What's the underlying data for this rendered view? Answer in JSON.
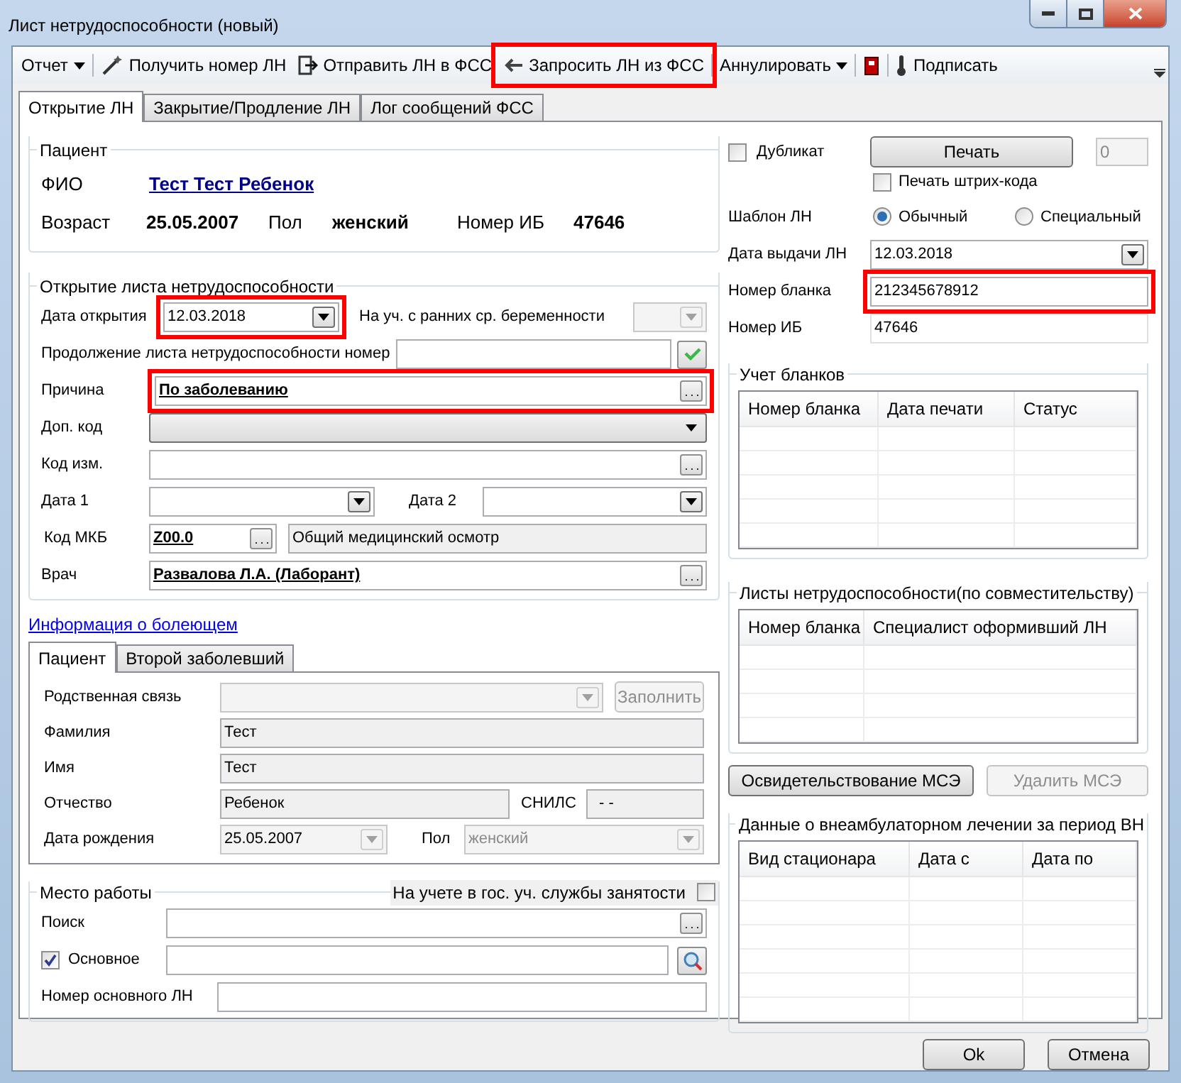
{
  "window": {
    "title": "Лист нетрудоспособности (новый)"
  },
  "toolbar": [
    {
      "kind": "dropdown",
      "label": "Отчет",
      "highlighted": false
    },
    {
      "kind": "button",
      "label": "Получить номер ЛН",
      "highlighted": false
    },
    {
      "kind": "button",
      "label": "Отправить ЛН в ФСС",
      "highlighted": false
    },
    {
      "kind": "button",
      "label": "Запросить ЛН из ФСС",
      "highlighted": true
    },
    {
      "kind": "dropdown",
      "label": "Аннулировать",
      "highlighted": false
    },
    {
      "kind": "icon",
      "highlighted": false
    },
    {
      "kind": "button",
      "label": "Подписать",
      "highlighted": false
    }
  ],
  "tabs": [
    {
      "label": "Открытие ЛН",
      "selected": true
    },
    {
      "label": "Закрытие/Продление ЛН",
      "selected": false
    },
    {
      "label": "Лог сообщений ФСС",
      "selected": false
    }
  ],
  "patient": {
    "title": "Пациент",
    "fio_label": "ФИО",
    "fio": "Тест Тест Ребенок",
    "age_label": "Возраст",
    "age": "25.05.2007",
    "sex_label": "Пол",
    "sex": "женский",
    "ib_label": "Номер ИБ",
    "ib": "47646"
  },
  "opening": {
    "title": "Открытие листа нетрудоспособности",
    "open_date": {
      "label": "Дата открытия",
      "value": "12.03.2018",
      "highlighted": true
    },
    "pregnancy": {
      "label": "На уч. с ранних ср. беременности",
      "disabled": true
    },
    "continuation": {
      "label": "Продолжение листа нетрудоспособности номер"
    },
    "reason": {
      "label": "Причина",
      "value": "По заболеванию",
      "highlighted": true
    },
    "extra_code": {
      "label": "Доп. код"
    },
    "change_code": {
      "label": "Код изм."
    },
    "date1": {
      "label": "Дата 1"
    },
    "date2": {
      "label": "Дата 2"
    },
    "mkb": {
      "label": "Код МКБ",
      "code": "Z00.0",
      "description": "Общий медицинский осмотр"
    },
    "doctor": {
      "label": "Врач",
      "value": "Развалова Л.А. (Лаборант)"
    }
  },
  "sick_info_link": "Информация о болеющем",
  "sub_tabs": [
    {
      "label": "Пациент",
      "selected": true
    },
    {
      "label": "Второй заболевший",
      "selected": false
    }
  ],
  "patient_info": {
    "relation": {
      "label": "Родственная связь",
      "disabled": true
    },
    "fill_button": {
      "label": "Заполнить",
      "disabled": true
    },
    "surname": {
      "label": "Фамилия",
      "value": "Тест"
    },
    "name": {
      "label": "Имя",
      "value": "Тест"
    },
    "patronymic": {
      "label": "Отчество",
      "value": "Ребенок"
    },
    "snils": {
      "label": "СНИЛС",
      "value": "-  -"
    },
    "birth_date": {
      "label": "Дата рождения",
      "value": "25.05.2007"
    },
    "sex": {
      "label": "Пол",
      "value": "женский"
    }
  },
  "work": {
    "title": "Место работы",
    "unemployed": {
      "label": "На учете в гос. уч. службы занятости",
      "checked": false
    },
    "search": {
      "label": "Поиск"
    },
    "main": {
      "label": "Основное",
      "checked": true
    },
    "main_number": {
      "label": "Номер основного ЛН"
    }
  },
  "right": {
    "duplicate": {
      "label": "Дубликат",
      "checked": false
    },
    "print_button": "Печать",
    "copies": "0",
    "barcode": {
      "label": "Печать штрих-кода",
      "checked": false
    },
    "template": {
      "label": "Шаблон ЛН",
      "options": [
        {
          "label": "Обычный",
          "selected": true
        },
        {
          "label": "Специальный",
          "selected": false
        }
      ]
    },
    "issue_date": {
      "label": "Дата выдачи ЛН",
      "value": "12.03.2018"
    },
    "blank_number": {
      "label": "Номер бланка",
      "value": "212345678912",
      "highlighted": true
    },
    "ib_number": {
      "label": "Номер ИБ",
      "value": "47646"
    }
  },
  "blanks": {
    "title": "Учет бланков",
    "columns": [
      "Номер бланка",
      "Дата печати",
      "Статус"
    ]
  },
  "part_time": {
    "title": "Листы нетрудоспособности(по совместительству)",
    "columns": [
      "Номер бланка",
      "Специалист оформивший ЛН"
    ]
  },
  "mse_buttons": [
    {
      "label": "Освидетельствование МСЭ",
      "disabled": false
    },
    {
      "label": "Удалить МСЭ",
      "disabled": true
    }
  ],
  "inpatient": {
    "title": "Данные о внеамбулаторном лечении за период ВН",
    "columns": [
      "Вид стационара",
      "Дата с",
      "Дата по"
    ]
  },
  "footer": [
    "Ok",
    "Отмена"
  ]
}
